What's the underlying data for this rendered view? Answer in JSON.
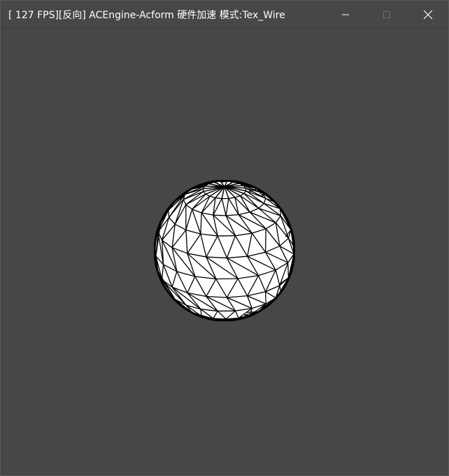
{
  "window": {
    "title": "[ 127 FPS][反向] ACEngine-Acform 硬件加速 模式:Tex_Wire"
  },
  "controls": {
    "minimize_icon": "minimize-icon",
    "maximize_icon": "maximize-icon",
    "close_icon": "close-icon"
  },
  "scene": {
    "object": "wireframe-sphere",
    "mode": "Tex_Wire",
    "background": "#474747",
    "fill_color": "#ffffff",
    "wire_color": "#000000"
  }
}
